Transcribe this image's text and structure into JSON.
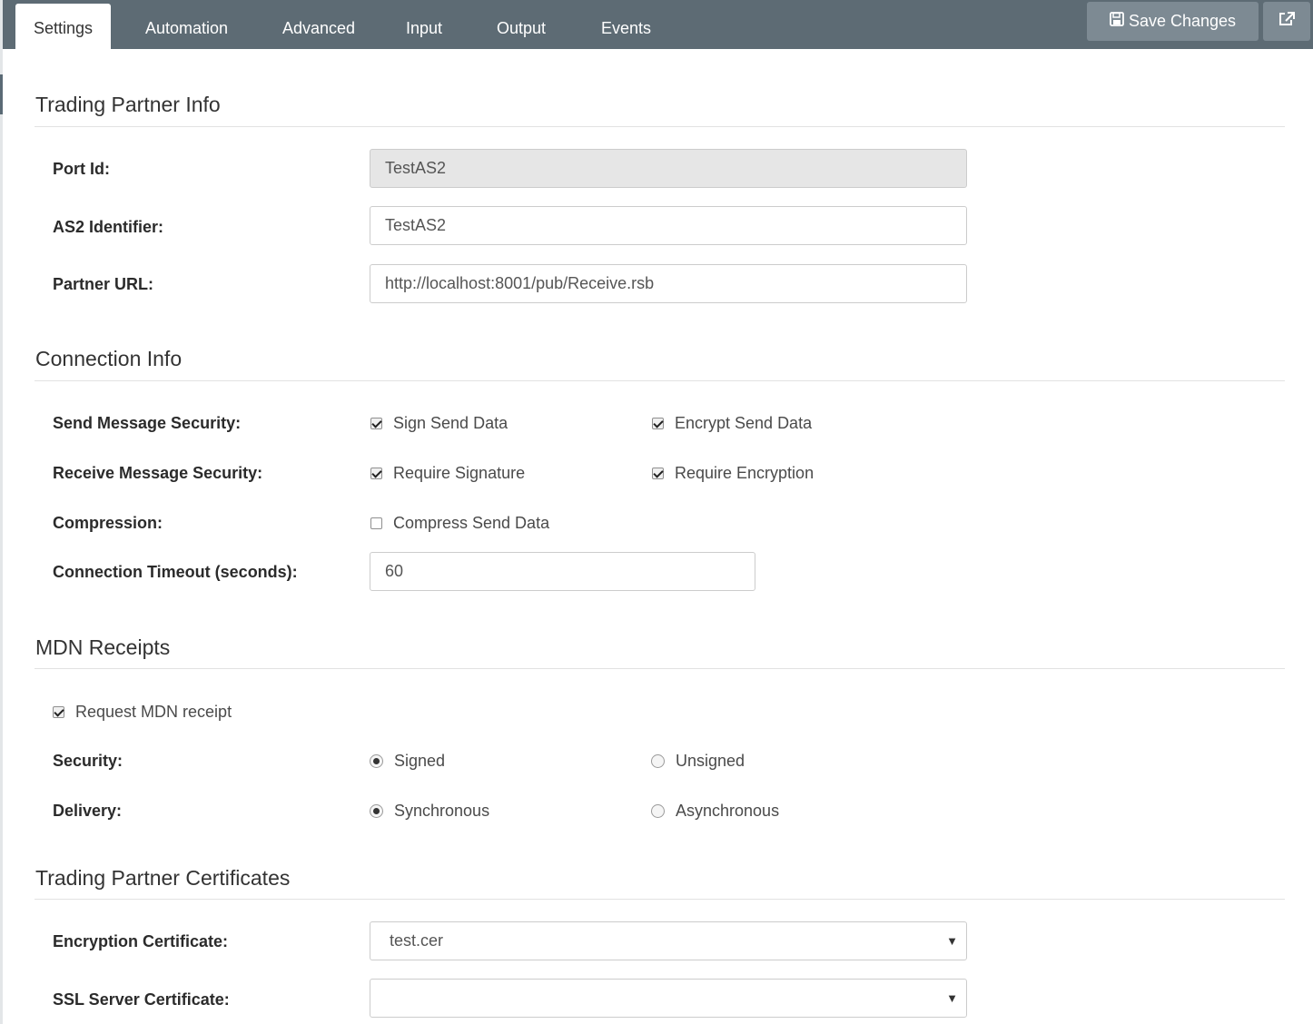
{
  "tabs": [
    {
      "label": "Settings",
      "active": true
    },
    {
      "label": "Automation"
    },
    {
      "label": "Advanced"
    },
    {
      "label": "Input"
    },
    {
      "label": "Output"
    },
    {
      "label": "Events"
    }
  ],
  "toolbar": {
    "save_label": "Save Changes",
    "save_icon": "floppy-disk-icon",
    "external_icon": "external-link-icon"
  },
  "trading_partner_info": {
    "title": "Trading Partner Info",
    "port_id_label": "Port Id:",
    "port_id_value": "TestAS2",
    "as2_identifier_label": "AS2 Identifier:",
    "as2_identifier_value": "TestAS2",
    "partner_url_label": "Partner URL:",
    "partner_url_value": "http://localhost:8001/pub/Receive.rsb"
  },
  "connection_info": {
    "title": "Connection Info",
    "send_security_label": "Send Message Security:",
    "sign_send_data": {
      "label": "Sign Send Data",
      "checked": true
    },
    "encrypt_send_data": {
      "label": "Encrypt Send Data",
      "checked": true
    },
    "receive_security_label": "Receive Message Security:",
    "require_signature": {
      "label": "Require Signature",
      "checked": true
    },
    "require_encryption": {
      "label": "Require Encryption",
      "checked": true
    },
    "compression_label": "Compression:",
    "compress_send_data": {
      "label": "Compress Send Data",
      "checked": false
    },
    "timeout_label": "Connection Timeout (seconds):",
    "timeout_value": "60"
  },
  "mdn_receipts": {
    "title": "MDN Receipts",
    "request_mdn": {
      "label": "Request MDN receipt",
      "checked": true
    },
    "security_label": "Security:",
    "security_options": [
      {
        "label": "Signed",
        "selected": true
      },
      {
        "label": "Unsigned",
        "selected": false
      }
    ],
    "delivery_label": "Delivery:",
    "delivery_options": [
      {
        "label": "Synchronous",
        "selected": true
      },
      {
        "label": "Asynchronous",
        "selected": false
      }
    ]
  },
  "certificates": {
    "title": "Trading Partner Certificates",
    "encryption_cert_label": "Encryption Certificate:",
    "encryption_cert_value": "test.cer",
    "ssl_cert_label": "SSL Server Certificate:",
    "ssl_cert_value": ""
  },
  "colors": {
    "topbar": "#5d6b74",
    "button": "#7d8a93",
    "readonly_field": "#e6e6e6"
  }
}
